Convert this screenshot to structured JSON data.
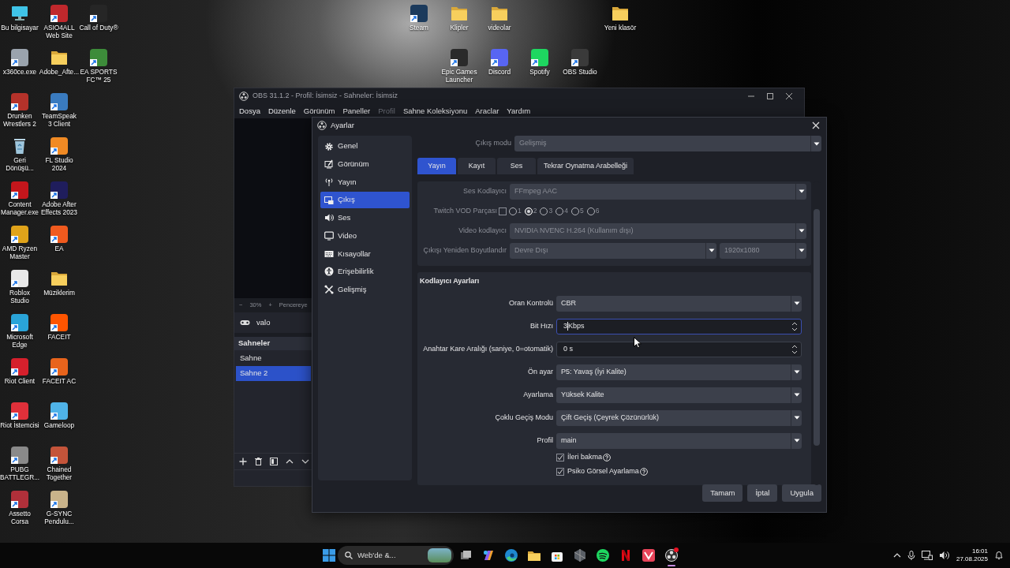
{
  "desktop": {
    "left_columns": [
      [
        {
          "label": "Bu bilgisayar",
          "kind": "pc"
        },
        {
          "label": "x360ce.exe",
          "kind": "app",
          "color": "#9aa3ad"
        },
        {
          "label": "Drunken Wrestlers 2",
          "kind": "app",
          "color": "#b5322a"
        },
        {
          "label": "Geri Dönüşü...",
          "kind": "recycle"
        },
        {
          "label": "Content Manager.exe",
          "kind": "app",
          "color": "#c4161c"
        },
        {
          "label": "AMD Ryzen Master",
          "kind": "app",
          "color": "#e0a31a"
        },
        {
          "label": "Roblox Studio",
          "kind": "app",
          "color": "#e8e8e8"
        },
        {
          "label": "Microsoft Edge",
          "kind": "app",
          "color": "#2aa4d8"
        },
        {
          "label": "Riot Client",
          "kind": "app",
          "color": "#d6202c"
        },
        {
          "label": "Riot İstemcisi",
          "kind": "app",
          "color": "#e0303a"
        },
        {
          "label": "PUBG BATTLEGR...",
          "kind": "app",
          "color": "#8a8a8a"
        },
        {
          "label": "Assetto Corsa",
          "kind": "app",
          "color": "#b0303a"
        }
      ],
      [
        {
          "label": "ASIO4ALL Web Site",
          "kind": "app",
          "color": "#c0282c"
        },
        {
          "label": "Adobe_Afte...",
          "kind": "folder"
        },
        {
          "label": "TeamSpeak 3 Client",
          "kind": "app",
          "color": "#3a7bbf"
        },
        {
          "label": "FL Studio 2024",
          "kind": "app",
          "color": "#f08a24"
        },
        {
          "label": "Adobe After Effects 2023",
          "kind": "app",
          "color": "#1f1d5c"
        },
        {
          "label": "EA",
          "kind": "app",
          "color": "#f05a1e"
        },
        {
          "label": "Müziklerim",
          "kind": "folder"
        },
        {
          "label": "FACEIT",
          "kind": "app",
          "color": "#ff5500"
        },
        {
          "label": "FACEIT AC",
          "kind": "app",
          "color": "#e8641c"
        },
        {
          "label": "Gameloop",
          "kind": "app",
          "color": "#4fb3e8"
        },
        {
          "label": "Chained Together",
          "kind": "app",
          "color": "#c4543a"
        },
        {
          "label": "G-SYNC Pendulu...",
          "kind": "app",
          "color": "#c9b38a"
        }
      ],
      [
        {
          "label": "Call of Duty®",
          "kind": "app",
          "color": "#262626"
        },
        {
          "label": "EA SPORTS FC™ 25",
          "kind": "app",
          "color": "#3d8c3a"
        }
      ]
    ],
    "top_rows": [
      [
        {
          "label": "Steam",
          "kind": "app",
          "color": "#1b3a5c"
        },
        {
          "label": "Klipler",
          "kind": "folder"
        },
        {
          "label": "videolar",
          "kind": "folder"
        },
        {
          "label": "Yeni klasör",
          "kind": "folder"
        }
      ],
      [
        {
          "label": "Epic Games Launcher",
          "kind": "app",
          "color": "#2a2a2a"
        },
        {
          "label": "Discord",
          "kind": "app",
          "color": "#5865f2"
        },
        {
          "label": "Spotify",
          "kind": "app",
          "color": "#1ed760"
        },
        {
          "label": "OBS Studio",
          "kind": "app",
          "color": "#3a3a3a"
        }
      ]
    ]
  },
  "obs": {
    "title": "OBS 31.1.2 - Profil: İsimsiz - Sahneler: İsimsiz",
    "menu": [
      {
        "label": "Dosya",
        "disabled": false
      },
      {
        "label": "Düzenle",
        "disabled": false
      },
      {
        "label": "Görünüm",
        "disabled": false
      },
      {
        "label": "Paneller",
        "disabled": false
      },
      {
        "label": "Profil",
        "disabled": true
      },
      {
        "label": "Sahne Koleksiyonu",
        "disabled": false
      },
      {
        "label": "Araclar",
        "disabled": false
      },
      {
        "label": "Yardım",
        "disabled": false
      }
    ],
    "zoom": {
      "minus": "−",
      "value": "30%",
      "plus": "+",
      "fit": "Pencereye"
    },
    "source": "valo",
    "scenes": {
      "title": "Sahneler",
      "items": [
        {
          "label": "Sahne",
          "selected": false
        },
        {
          "label": "Sahne 2",
          "selected": true
        }
      ]
    }
  },
  "settings": {
    "title": "Ayarlar",
    "sidebar": [
      {
        "label": "Genel",
        "kind": "gear",
        "selected": false
      },
      {
        "label": "Görünüm",
        "kind": "brush",
        "selected": false
      },
      {
        "label": "Yayın",
        "kind": "antenna",
        "selected": false
      },
      {
        "label": "Çıkış",
        "kind": "output",
        "selected": true
      },
      {
        "label": "Ses",
        "kind": "speaker",
        "selected": false
      },
      {
        "label": "Video",
        "kind": "monitor",
        "selected": false
      },
      {
        "label": "Kısayollar",
        "kind": "keyboard",
        "selected": false
      },
      {
        "label": "Erişebilirlik",
        "kind": "person",
        "selected": false
      },
      {
        "label": "Gelişmiş",
        "kind": "tools",
        "selected": false
      }
    ],
    "output_mode": {
      "label": "Çıkış modu",
      "value": "Gelişmiş"
    },
    "tabs": [
      {
        "label": "Yayın",
        "selected": true
      },
      {
        "label": "Kayıt",
        "selected": false
      },
      {
        "label": "Ses",
        "selected": false
      },
      {
        "label": "Tekrar Oynatma Arabelleği",
        "selected": false
      }
    ],
    "stream_group": [
      {
        "kind": "select",
        "label": "Ses Kodlayıcı",
        "value": "FFmpeg AAC",
        "disabled": true
      },
      {
        "kind": "tracks",
        "label": "Twitch VOD Parçası",
        "checked": false,
        "tracks": [
          {
            "label": "1",
            "selected": false
          },
          {
            "label": "2",
            "selected": true
          },
          {
            "label": "3",
            "selected": false
          },
          {
            "label": "4",
            "selected": false
          },
          {
            "label": "5",
            "selected": false
          },
          {
            "label": "6",
            "selected": false
          }
        ]
      },
      {
        "kind": "select",
        "label": "Video kodlayıcı",
        "value": "NVIDIA NVENC H.264 (Kullanım dışı)",
        "disabled": true
      },
      {
        "kind": "select_pair",
        "label": "Çıkışı Yeniden Boyutlandır",
        "value": "Devre Dışı",
        "value_2": "1920x1080",
        "disabled": true
      }
    ],
    "encoder_group": {
      "title": "Kodlayıcı Ayarları",
      "rows": [
        {
          "kind": "select",
          "label": "Oran Kontrolü",
          "value": "CBR",
          "disabled": false
        },
        {
          "kind": "spin",
          "label": "Bit Hızı",
          "value": "3",
          "suffix": "Kbps",
          "focused": true
        },
        {
          "kind": "spin",
          "label": "Anahtar Kare Aralığı (saniye, 0=otomatik)",
          "value": "0 s",
          "focused": false
        },
        {
          "kind": "select",
          "label": "Ön ayar",
          "value": "P5: Yavaş (İyi Kalite)",
          "disabled": false
        },
        {
          "kind": "select",
          "label": "Ayarlama",
          "value": "Yüksek Kalite",
          "disabled": false
        },
        {
          "kind": "select",
          "label": "Çoklu Geçiş Modu",
          "value": "Çift Geçiş (Çeyrek Çözünürlük)",
          "disabled": false
        },
        {
          "kind": "select",
          "label": "Profil",
          "value": "main",
          "disabled": false
        },
        {
          "kind": "checkbox",
          "label": "İleri bakma",
          "checked": true,
          "help": true
        },
        {
          "kind": "checkbox",
          "label": "Psiko Görsel Ayarlama",
          "checked": true,
          "help": true
        }
      ]
    },
    "buttons": [
      "Tamam",
      "İptal",
      "Uygula"
    ]
  },
  "taskbar": {
    "search": "Web'de &...",
    "apps": [
      {
        "kind": "taskview",
        "active": false,
        "notification": false
      },
      {
        "kind": "copilot",
        "active": false,
        "notification": false
      },
      {
        "kind": "browser",
        "active": false,
        "notification": false
      },
      {
        "kind": "folder",
        "active": false,
        "notification": false
      },
      {
        "kind": "store",
        "active": false,
        "notification": false
      },
      {
        "kind": "hexagon",
        "active": false,
        "notification": false
      },
      {
        "kind": "music",
        "active": false,
        "notification": false
      },
      {
        "kind": "ribbon",
        "active": false,
        "notification": false
      },
      {
        "kind": "tile",
        "active": false,
        "notification": false
      },
      {
        "kind": "obs",
        "active": true,
        "notification": true
      }
    ],
    "time": "16:01",
    "date": "27.08.2025"
  }
}
